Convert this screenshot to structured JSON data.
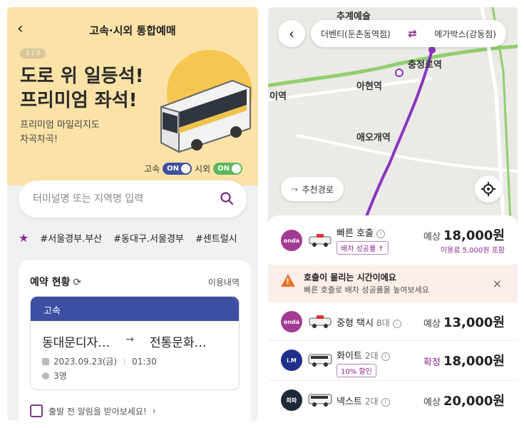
{
  "left": {
    "title": "고속·시외 통합예매",
    "pager": "1 / 3",
    "headline1": "도로 위 일등석!",
    "headline2": "프리미엄 좌석!",
    "sub1": "프리미엄 마일리지도",
    "sub2": "차곡차곡!",
    "toggles": [
      {
        "label": "고속",
        "state": "ON"
      },
      {
        "label": "시외",
        "state": "ON"
      }
    ],
    "search_placeholder": "터미널명 또는 지역명 입력",
    "tags": [
      "#서울경부.부산",
      "#동대구.서울경부",
      "#센트럴시"
    ],
    "reservation": {
      "title": "예약 현황",
      "link": "이용내역",
      "ticket_type": "고속",
      "from": "동대문디자…",
      "to": "전통문화…",
      "date": "2023.09.23(금)",
      "time": "01:30",
      "people": "3명",
      "notice": "출발 전 알림을 받아보세요!"
    }
  },
  "right": {
    "origin": "더벤티(둔촌동역점)",
    "destination": "메가박스(강동점)",
    "map_labels": [
      "추계예술",
      "충정로역",
      "아현역",
      "애오개역",
      "이역"
    ],
    "recommend": "추천경로",
    "options": [
      {
        "brand": "onda",
        "name": "빠른 호출",
        "count": "",
        "chip": "배차 성공률 ↑",
        "price_prefix": "예상",
        "price": "18,000원",
        "fee": "이용료 5,000원 포함"
      },
      {
        "brand": "onda",
        "name": "중형 택시",
        "count": "8대",
        "chip": "",
        "price_prefix": "예상",
        "price": "13,000원",
        "fee": ""
      },
      {
        "brand": "i.M",
        "name": "화이트",
        "count": "2대",
        "chip": "10% 할인",
        "price_prefix": "확정",
        "price": "18,000원",
        "fee": ""
      },
      {
        "brand": "파파",
        "name": "넥스트",
        "count": "2대",
        "chip": "",
        "price_prefix": "예상",
        "price": "20,000원",
        "fee": ""
      }
    ],
    "warning": {
      "title": "호출이 몰리는 시간이에요",
      "sub": "빠른 호출로 배차 성공률을 높여보세요"
    }
  },
  "colors": {
    "brand_purple": "#8a2a8e",
    "kobus_blue": "#3c4fa3",
    "banner_yellow": "#fbe3a8"
  }
}
